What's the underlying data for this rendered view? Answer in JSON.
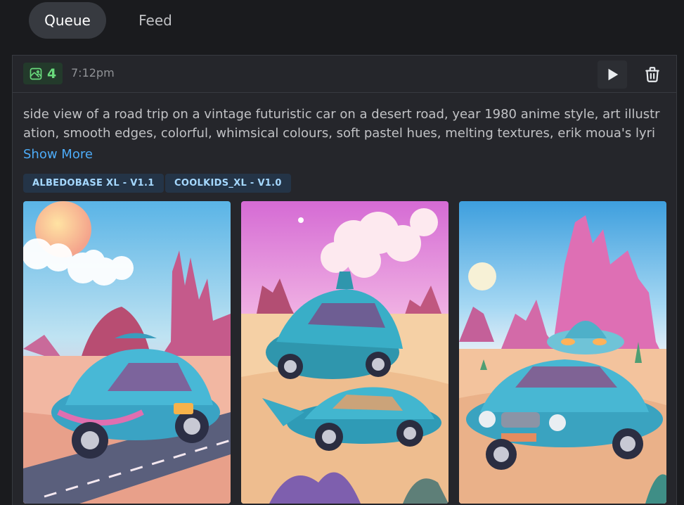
{
  "tabs": [
    {
      "label": "Queue",
      "active": true
    },
    {
      "label": "Feed",
      "active": false
    }
  ],
  "job": {
    "image_count": "4",
    "time": "7:12pm",
    "prompt": "side view of a road trip on a vintage futuristic car on a desert road, year 1980 anime style, art illustration, smooth edges, colorful, whimsical colours, soft pastel hues, melting textures, erik moua's lyri",
    "show_more_label": "Show More",
    "models": [
      "ALBEDOBASE XL - V1.1",
      "COOLKIDS_XL - V1.0"
    ]
  },
  "icons": {
    "image": "image-icon",
    "play": "play-icon",
    "trash": "trash-icon"
  },
  "images": [
    {
      "alt": "desert road trip with blue vintage car"
    },
    {
      "alt": "two turquoise futuristic cars in pink desert"
    },
    {
      "alt": "teal car with spaceship roof in pink canyon"
    }
  ],
  "colors": {
    "accent_green": "#69db7c",
    "link_blue": "#4dabf7",
    "badge_text": "#a5d8ff"
  }
}
